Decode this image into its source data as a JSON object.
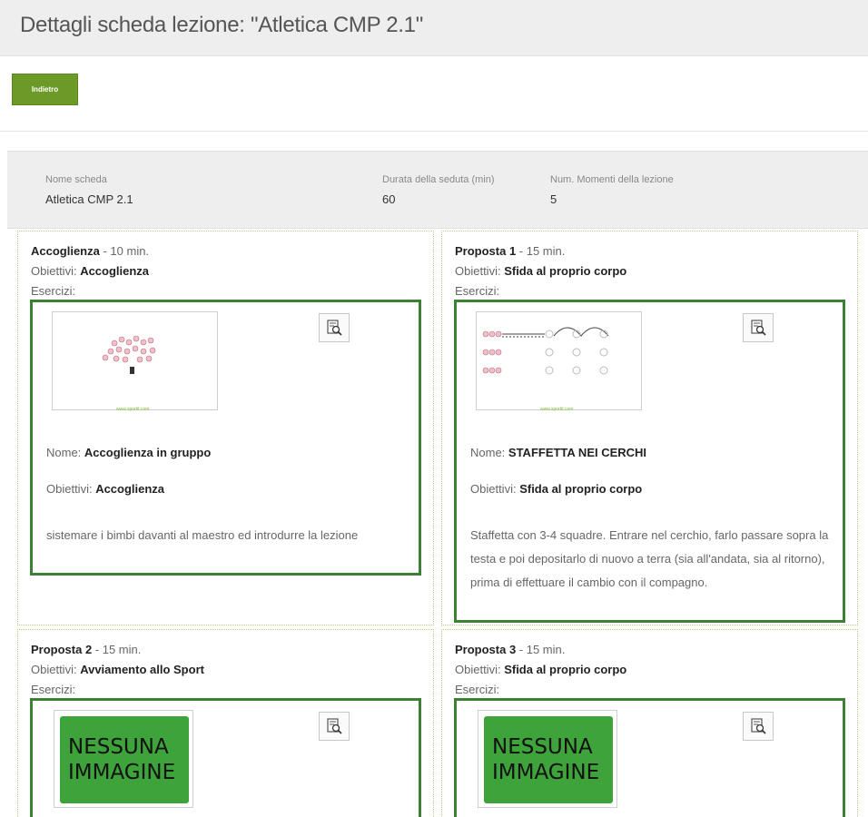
{
  "header": {
    "title": "Dettagli scheda lezione: \"Atletica CMP 2.1\""
  },
  "toolbar": {
    "back_label": "Indietro"
  },
  "summary": {
    "name_label": "Nome scheda",
    "name_value": "Atletica CMP 2.1",
    "duration_label": "Durata della seduta (min)",
    "duration_value": "60",
    "moments_label": "Num. Momenti della lezione",
    "moments_value": "5"
  },
  "labels": {
    "objectives": "Obiettivi: ",
    "exercises": "Esercizi:",
    "name": "Nome: ",
    "no_image": "NESSUNA IMMAGINE",
    "watermark": "www.sportit.com"
  },
  "moments": [
    {
      "title": "Accoglienza",
      "duration": " - 10 min.",
      "objective": "Accoglienza",
      "exercise": {
        "name": "Accoglienza in gruppo",
        "objective": "Accoglienza",
        "description": "sistemare i bimbi davanti al maestro ed introdurre la lezione"
      }
    },
    {
      "title": "Proposta 1",
      "duration": " - 15 min.",
      "objective": "Sfida al proprio corpo",
      "exercise": {
        "name": "STAFFETTA NEI CERCHI",
        "objective": "Sfida al proprio corpo",
        "description": "Staffetta con 3-4 squadre. Entrare nel cerchio, farlo passare sopra la testa e poi depositarlo di nuovo a terra (sia all'andata, sia al ritorno), prima di effettuare il cambio con il compagno."
      }
    },
    {
      "title": "Proposta 2",
      "duration": " - 15 min.",
      "objective": "Avviamento allo Sport"
    },
    {
      "title": "Proposta 3",
      "duration": " - 15 min.",
      "objective": "Sfida al proprio corpo"
    }
  ],
  "icons": {
    "zoom": "document-search-icon"
  },
  "colors": {
    "accent": "#6c9a26",
    "box_border": "#3d7f35",
    "no_image_bg": "#3ea33a"
  }
}
